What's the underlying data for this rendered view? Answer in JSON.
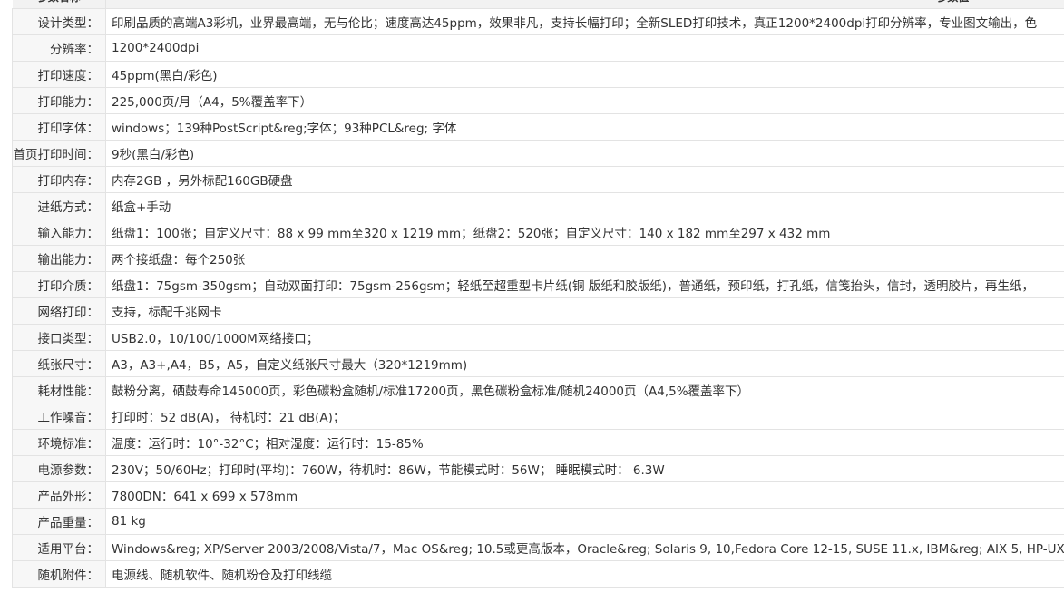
{
  "header": {
    "label_col": "参数名称",
    "value_col": "参数值"
  },
  "specs": [
    {
      "label": "设计类型：",
      "value": "印刷品质的高端A3彩机，业界最高端，无与伦比；速度高达45ppm，效果非凡，支持长幅打印；全新SLED打印技术，真正1200*2400dpi打印分辨率，专业图文输出，色"
    },
    {
      "label": "分辨率：",
      "value": "1200*2400dpi"
    },
    {
      "label": "打印速度：",
      "value": "45ppm(黑白/彩色)"
    },
    {
      "label": "打印能力：",
      "value": "225,000页/月（A4，5%覆盖率下）"
    },
    {
      "label": "打印字体：",
      "value": "windows；139种PostScript&reg;字体；93种PCL&reg; 字体"
    },
    {
      "label": "首页打印时间：",
      "value": "9秒(黑白/彩色)"
    },
    {
      "label": "打印内存：",
      "value": "内存2GB ，另外标配160GB硬盘"
    },
    {
      "label": "进纸方式：",
      "value": "纸盒+手动"
    },
    {
      "label": "输入能力：",
      "value": "纸盘1：100张；自定义尺寸：88 x 99 mm至320 x 1219 mm；纸盘2：520张；自定义尺寸：140 x 182 mm至297 x 432 mm"
    },
    {
      "label": "输出能力：",
      "value": "两个接纸盘：每个250张"
    },
    {
      "label": "打印介质：",
      "value": "纸盘1：75gsm-350gsm；自动双面打印：75gsm-256gsm；轻纸至超重型卡片纸(铜 版纸和胶版纸)，普通纸，预印纸，打孔纸，信笺抬头，信封，透明胶片，再生纸，"
    },
    {
      "label": "网络打印：",
      "value": "支持，标配千兆网卡"
    },
    {
      "label": "接口类型：",
      "value": "USB2.0，10/100/1000M网络接口；"
    },
    {
      "label": "纸张尺寸：",
      "value": "A3，A3+,A4，B5，A5，自定义纸张尺寸最大（320*1219mm)"
    },
    {
      "label": "耗材性能：",
      "value": "鼓粉分离，硒鼓寿命145000页，彩色碳粉盒随机/标准17200页，黑色碳粉盒标准/随机24000页（A4,5%覆盖率下）"
    },
    {
      "label": "工作噪音：",
      "value": "打印时：52 dB(A)， 待机时：21 dB(A)；"
    },
    {
      "label": "环境标准：",
      "value": "温度：运行时：10°-32°C；相对湿度：运行时：15-85%"
    },
    {
      "label": "电源参数：",
      "value": "230V；50/60Hz；打印时(平均)：760W，待机时：86W，节能模式时：56W； 睡眠模式时： 6.3W"
    },
    {
      "label": "产品外形：",
      "value": "7800DN：641 x 699 x 578mm"
    },
    {
      "label": "产品重量：",
      "value": "81 kg"
    },
    {
      "label": "适用平台：",
      "value": "Windows&reg; XP/Server 2003/2008/Vista/7，Mac OS&reg; 10.5或更高版本，Oracle&reg; Solaris 9, 10,Fedora Core 12-15, SUSE 11.x, IBM&reg; AIX 5, HP-UX"
    },
    {
      "label": "随机附件：",
      "value": "电源线、随机软件、随机粉仓及打印线缆"
    }
  ]
}
